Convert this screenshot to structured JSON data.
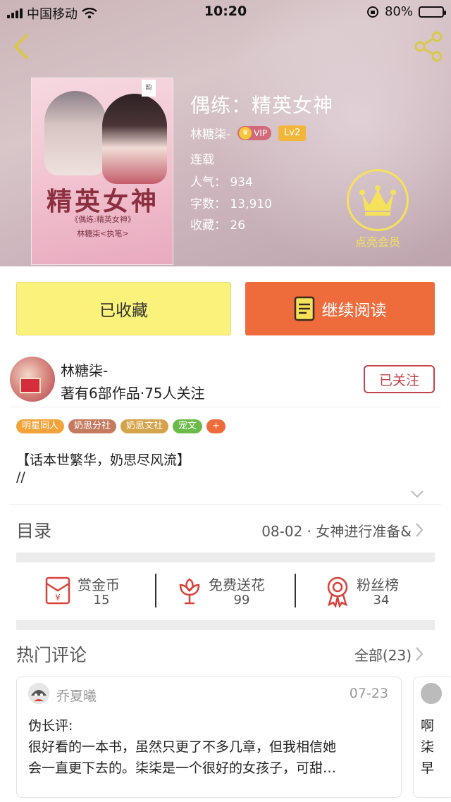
{
  "status_bar": {
    "carrier": "中国移动",
    "time": "10:20",
    "battery": "80%"
  },
  "book": {
    "cover": {
      "title": "精英女神",
      "subtitle": "《偶练:精英女神》",
      "author_line": "林糖柒<执笔>",
      "tag": "韵"
    },
    "title": "偶练：精英女神",
    "author": "林糖柒-",
    "vip_label": "VIP",
    "level": "Lv2",
    "status": "连载",
    "popularity": "人气：  934",
    "word_count": "字数：  13,910",
    "favorites": "收藏：  26",
    "member_label": "点亮会员"
  },
  "actions": {
    "collected_label": "已收藏",
    "continue_label": "继续阅读"
  },
  "author_section": {
    "name": "林糖柒-",
    "info": "著有6部作品·75人关注",
    "follow_label": "已关注"
  },
  "tags": [
    {
      "label": "明星同人",
      "color": "#f2a33a"
    },
    {
      "label": "奶思分社",
      "color": "#c47a5e"
    },
    {
      "label": "奶思文社",
      "color": "#d4a34a"
    },
    {
      "label": "宠文",
      "color": "#6cbb4a"
    },
    {
      "label": "+",
      "color": "#ee6b3c"
    }
  ],
  "blurb": {
    "line1": "【话本世繁华，奶思尽风流】",
    "line2": "//"
  },
  "toc": {
    "label": "目录",
    "latest": "08-02 · 女神进行准备&"
  },
  "stats": [
    {
      "label": "赏金币",
      "value": "15",
      "icon": "red-envelope-icon"
    },
    {
      "label": "免费送花",
      "value": "99",
      "icon": "flower-icon"
    },
    {
      "label": "粉丝榜",
      "value": "34",
      "icon": "medal-icon"
    }
  ],
  "comments": {
    "label": "热门评论",
    "all_link": "全部(23)",
    "items": [
      {
        "user": "乔夏曦",
        "date": "07-23",
        "line1": "伪长评:",
        "line2": "很好看的一本书，虽然只更了不多几章，但我相信她",
        "line3": "会一直更下去的。柒柒是一个很好的女孩子，可甜…"
      },
      {
        "line1": "啊",
        "line2": "柒",
        "line3": "早"
      }
    ]
  },
  "colors": {
    "accent": "#ee6b3c",
    "collected_bg": "#faf27a",
    "follow": "#c1444a",
    "member": "#f6e25a"
  }
}
